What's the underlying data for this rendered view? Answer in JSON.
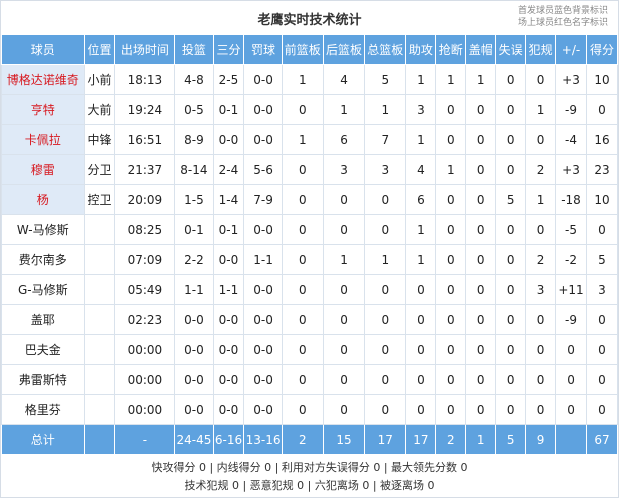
{
  "title": "老鹰实时技术统计",
  "legend": [
    "首发球员蓝色背景标识",
    "场上球员红色名字标识"
  ],
  "columns": [
    "球员",
    "位置",
    "出场时间",
    "投篮",
    "三分",
    "罚球",
    "前篮板",
    "后篮板",
    "总篮板",
    "助攻",
    "抢断",
    "盖帽",
    "失误",
    "犯规",
    "+/-",
    "得分"
  ],
  "players": [
    {
      "name": "博格达诺维奇",
      "pos": "小前",
      "min": "18:13",
      "fg": "4-8",
      "tp": "2-5",
      "ft": "0-0",
      "oreb": "1",
      "dreb": "4",
      "reb": "5",
      "ast": "1",
      "stl": "1",
      "blk": "1",
      "tov": "0",
      "pf": "0",
      "pm": "+3",
      "pts": "10",
      "starter": true
    },
    {
      "name": "亨特",
      "pos": "大前",
      "min": "19:24",
      "fg": "0-5",
      "tp": "0-1",
      "ft": "0-0",
      "oreb": "0",
      "dreb": "1",
      "reb": "1",
      "ast": "3",
      "stl": "0",
      "blk": "0",
      "tov": "0",
      "pf": "1",
      "pm": "-9",
      "pts": "0",
      "starter": true
    },
    {
      "name": "卡佩拉",
      "pos": "中锋",
      "min": "16:51",
      "fg": "8-9",
      "tp": "0-0",
      "ft": "0-0",
      "oreb": "1",
      "dreb": "6",
      "reb": "7",
      "ast": "1",
      "stl": "0",
      "blk": "0",
      "tov": "0",
      "pf": "0",
      "pm": "-4",
      "pts": "16",
      "starter": true
    },
    {
      "name": "穆雷",
      "pos": "分卫",
      "min": "21:37",
      "fg": "8-14",
      "tp": "2-4",
      "ft": "5-6",
      "oreb": "0",
      "dreb": "3",
      "reb": "3",
      "ast": "4",
      "stl": "1",
      "blk": "0",
      "tov": "0",
      "pf": "2",
      "pm": "+3",
      "pts": "23",
      "starter": true
    },
    {
      "name": "杨",
      "pos": "控卫",
      "min": "20:09",
      "fg": "1-5",
      "tp": "1-4",
      "ft": "7-9",
      "oreb": "0",
      "dreb": "0",
      "reb": "0",
      "ast": "6",
      "stl": "0",
      "blk": "0",
      "tov": "5",
      "pf": "1",
      "pm": "-18",
      "pts": "10",
      "starter": true
    },
    {
      "name": "W-马修斯",
      "pos": "",
      "min": "08:25",
      "fg": "0-1",
      "tp": "0-1",
      "ft": "0-0",
      "oreb": "0",
      "dreb": "0",
      "reb": "0",
      "ast": "1",
      "stl": "0",
      "blk": "0",
      "tov": "0",
      "pf": "0",
      "pm": "-5",
      "pts": "0",
      "starter": false
    },
    {
      "name": "费尔南多",
      "pos": "",
      "min": "07:09",
      "fg": "2-2",
      "tp": "0-0",
      "ft": "1-1",
      "oreb": "0",
      "dreb": "1",
      "reb": "1",
      "ast": "1",
      "stl": "0",
      "blk": "0",
      "tov": "0",
      "pf": "2",
      "pm": "-2",
      "pts": "5",
      "starter": false
    },
    {
      "name": "G-马修斯",
      "pos": "",
      "min": "05:49",
      "fg": "1-1",
      "tp": "1-1",
      "ft": "0-0",
      "oreb": "0",
      "dreb": "0",
      "reb": "0",
      "ast": "0",
      "stl": "0",
      "blk": "0",
      "tov": "0",
      "pf": "3",
      "pm": "+11",
      "pts": "3",
      "starter": false
    },
    {
      "name": "盖耶",
      "pos": "",
      "min": "02:23",
      "fg": "0-0",
      "tp": "0-0",
      "ft": "0-0",
      "oreb": "0",
      "dreb": "0",
      "reb": "0",
      "ast": "0",
      "stl": "0",
      "blk": "0",
      "tov": "0",
      "pf": "0",
      "pm": "-9",
      "pts": "0",
      "starter": false
    },
    {
      "name": "巴夫金",
      "pos": "",
      "min": "00:00",
      "fg": "0-0",
      "tp": "0-0",
      "ft": "0-0",
      "oreb": "0",
      "dreb": "0",
      "reb": "0",
      "ast": "0",
      "stl": "0",
      "blk": "0",
      "tov": "0",
      "pf": "0",
      "pm": "0",
      "pts": "0",
      "starter": false
    },
    {
      "name": "弗雷斯特",
      "pos": "",
      "min": "00:00",
      "fg": "0-0",
      "tp": "0-0",
      "ft": "0-0",
      "oreb": "0",
      "dreb": "0",
      "reb": "0",
      "ast": "0",
      "stl": "0",
      "blk": "0",
      "tov": "0",
      "pf": "0",
      "pm": "0",
      "pts": "0",
      "starter": false
    },
    {
      "name": "格里芬",
      "pos": "",
      "min": "00:00",
      "fg": "0-0",
      "tp": "0-0",
      "ft": "0-0",
      "oreb": "0",
      "dreb": "0",
      "reb": "0",
      "ast": "0",
      "stl": "0",
      "blk": "0",
      "tov": "0",
      "pf": "0",
      "pm": "0",
      "pts": "0",
      "starter": false
    }
  ],
  "totals": {
    "name": "总计",
    "pos": "",
    "min": "-",
    "fg": "24-45",
    "tp": "6-16",
    "ft": "13-16",
    "oreb": "2",
    "dreb": "15",
    "reb": "17",
    "ast": "17",
    "stl": "2",
    "blk": "1",
    "tov": "5",
    "pf": "9",
    "pm": "",
    "pts": "67"
  },
  "footer": {
    "line1": "快攻得分 0 | 内线得分 0 | 利用对方失误得分 0 | 最大领先分数 0",
    "line2": "技术犯规 0 | 恶意犯规 0 | 六犯离场 0 | 被逐离场 0"
  },
  "colors": {
    "header": "#5ea2df",
    "starter_bg": "#dfeaf7",
    "on_court_name": "#d71920"
  }
}
